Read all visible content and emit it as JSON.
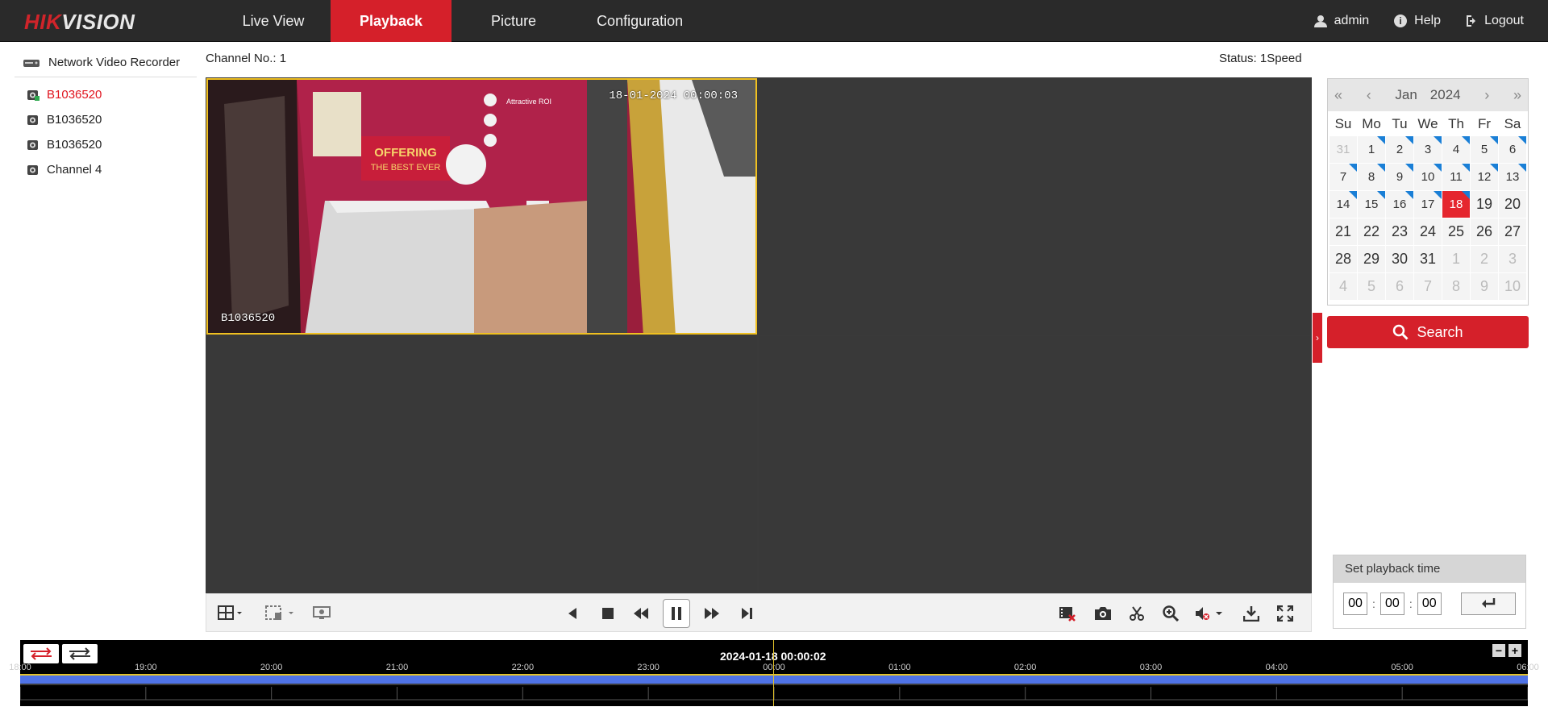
{
  "brand": {
    "part1": "HIK",
    "part2": "VISION"
  },
  "nav": [
    {
      "label": "Live View",
      "active": false
    },
    {
      "label": "Playback",
      "active": true
    },
    {
      "label": "Picture",
      "active": false
    },
    {
      "label": "Configuration",
      "active": false
    }
  ],
  "user": {
    "name": "admin",
    "help": "Help",
    "logout": "Logout"
  },
  "tree": {
    "root": "Network Video Recorder",
    "channels": [
      {
        "label": "B1036520",
        "selected": true
      },
      {
        "label": "B1036520",
        "selected": false
      },
      {
        "label": "B1036520",
        "selected": false
      },
      {
        "label": "Channel 4",
        "selected": false
      }
    ]
  },
  "header": {
    "channel": "Channel No.: 1",
    "status": "Status: 1Speed"
  },
  "video": {
    "osd_time": "18-01-2024 00:00:03",
    "osd_name": "B1036520"
  },
  "calendar": {
    "month": "Jan",
    "year": "2024",
    "weekdays": [
      "Su",
      "Mo",
      "Tu",
      "We",
      "Th",
      "Fr",
      "Sa"
    ],
    "days": [
      {
        "d": "31",
        "muted": true,
        "rec": false
      },
      {
        "d": "1",
        "rec": true
      },
      {
        "d": "2",
        "rec": true
      },
      {
        "d": "3",
        "rec": true
      },
      {
        "d": "4",
        "rec": true
      },
      {
        "d": "5",
        "rec": true
      },
      {
        "d": "6",
        "rec": true
      },
      {
        "d": "7",
        "rec": true
      },
      {
        "d": "8",
        "rec": true
      },
      {
        "d": "9",
        "rec": true
      },
      {
        "d": "10",
        "rec": true
      },
      {
        "d": "11",
        "rec": true
      },
      {
        "d": "12",
        "rec": true
      },
      {
        "d": "13",
        "rec": true
      },
      {
        "d": "14",
        "rec": true
      },
      {
        "d": "15",
        "rec": true
      },
      {
        "d": "16",
        "rec": true
      },
      {
        "d": "17",
        "rec": true
      },
      {
        "d": "18",
        "rec": true,
        "today": true
      },
      {
        "d": "19",
        "big": true
      },
      {
        "d": "20",
        "big": true
      },
      {
        "d": "21",
        "big": true
      },
      {
        "d": "22",
        "big": true
      },
      {
        "d": "23",
        "big": true
      },
      {
        "d": "24",
        "big": true
      },
      {
        "d": "25",
        "big": true
      },
      {
        "d": "26",
        "big": true
      },
      {
        "d": "27",
        "big": true
      },
      {
        "d": "28",
        "big": true
      },
      {
        "d": "29",
        "big": true
      },
      {
        "d": "30",
        "big": true
      },
      {
        "d": "31",
        "big": true
      },
      {
        "d": "1",
        "muted": true
      },
      {
        "d": "2",
        "muted": true
      },
      {
        "d": "3",
        "muted": true
      },
      {
        "d": "4",
        "muted": true
      },
      {
        "d": "5",
        "muted": true
      },
      {
        "d": "6",
        "muted": true
      },
      {
        "d": "7",
        "muted": true
      },
      {
        "d": "8",
        "muted": true
      },
      {
        "d": "9",
        "muted": true
      },
      {
        "d": "10",
        "muted": true
      }
    ]
  },
  "search": {
    "label": "Search"
  },
  "playback_time": {
    "title": "Set playback time",
    "hh": "00",
    "mm": "00",
    "ss": "00"
  },
  "timeline": {
    "date": "2024-01-18 00:00:02",
    "hours": [
      "18:00",
      "19:00",
      "20:00",
      "21:00",
      "22:00",
      "23:00",
      "00:00",
      "01:00",
      "02:00",
      "03:00",
      "04:00",
      "05:00",
      "06:00"
    ]
  },
  "colors": {
    "accent": "#d5202a",
    "record": "#4f73e6",
    "cursor": "#e3c22a"
  }
}
